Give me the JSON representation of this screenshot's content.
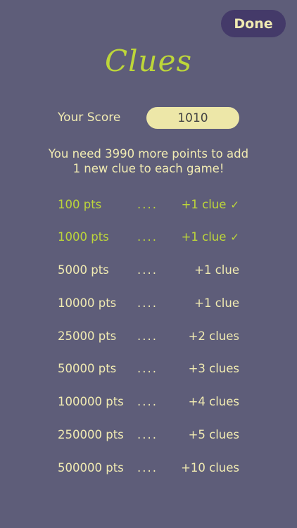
{
  "header": {
    "done_label": "Done"
  },
  "title": "Clues",
  "score": {
    "label": "Your Score",
    "value": "1010"
  },
  "message": {
    "line1": "You need 3990 more points to add",
    "line2": "1 new clue to each game!"
  },
  "dots": "....",
  "rewards": [
    {
      "points": "100 pts",
      "reward": "+1 clue",
      "achieved": true
    },
    {
      "points": "1000 pts",
      "reward": "+1 clue",
      "achieved": true
    },
    {
      "points": "5000 pts",
      "reward": "+1 clue",
      "achieved": false
    },
    {
      "points": "10000 pts",
      "reward": "+1 clue",
      "achieved": false
    },
    {
      "points": "25000 pts",
      "reward": "+2 clues",
      "achieved": false
    },
    {
      "points": "50000 pts",
      "reward": "+3 clues",
      "achieved": false
    },
    {
      "points": "100000 pts",
      "reward": "+4 clues",
      "achieved": false
    },
    {
      "points": "250000 pts",
      "reward": "+5 clues",
      "achieved": false
    },
    {
      "points": "500000 pts",
      "reward": "+10 clues",
      "achieved": false
    }
  ],
  "check_glyph": "✓",
  "colors": {
    "background": "#5e5d79",
    "accent": "#bdd63a",
    "text": "#f1ebb2",
    "button": "#443a69",
    "pill": "#ede7a8"
  }
}
